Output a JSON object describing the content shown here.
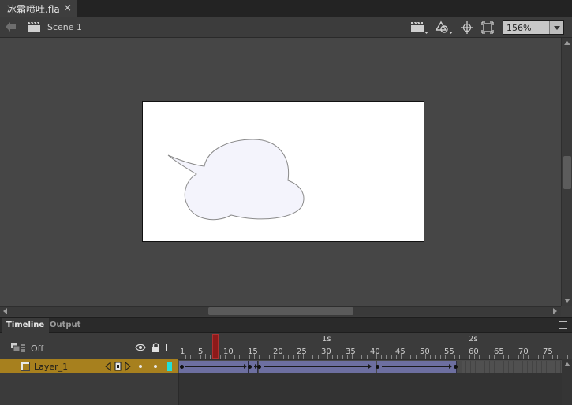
{
  "document_tab": {
    "title": "冰霜喷吐.fla",
    "close_glyph": "×"
  },
  "editbar": {
    "scene_label": "Scene 1",
    "zoom_value": "156%",
    "icons": [
      "back-arrow-icon",
      "scene-icon",
      "edit-scene-icon",
      "edit-symbols-icon",
      "snap-icon",
      "clip-to-stage-icon"
    ]
  },
  "panels": {
    "tabs": [
      "Timeline",
      "Output"
    ],
    "active_tab": "Timeline"
  },
  "timeline": {
    "onion_skin_label": "Off",
    "layer": {
      "name": "Layer_1",
      "color": "#22e0d8"
    },
    "ruler_seconds": [
      "1s",
      "2s"
    ],
    "ruler_frames": [
      "1",
      "5",
      "10",
      "15",
      "20",
      "25",
      "30",
      "35",
      "40",
      "45",
      "50",
      "55",
      "60",
      "65",
      "70",
      "75"
    ],
    "current_frame": 8,
    "keyframes": [
      1,
      15,
      17,
      41,
      57
    ],
    "last_frame": 57
  },
  "colors": {
    "layer_row": "#a7801e",
    "tween": "#6d6fa0",
    "playhead": "#c02020",
    "bubble_fill": "#f4f4fc"
  }
}
